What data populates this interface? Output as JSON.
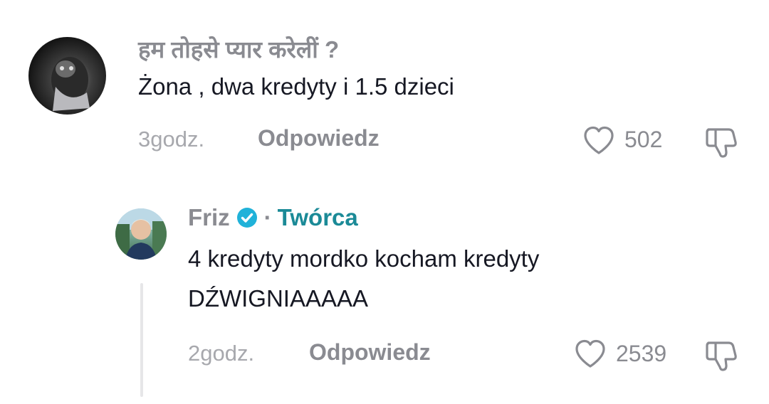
{
  "comments": [
    {
      "username": "हम तोहसे प्यार करेलीं ?",
      "text_lines": [
        "Żona , dwa kredyty i 1.5 dzieci"
      ],
      "time": "3godz.",
      "reply_label": "Odpowiedz",
      "likes": "502"
    }
  ],
  "reply": {
    "username": "Friz",
    "verified": true,
    "separator": "·",
    "creator_label": "Twórca",
    "text_lines": [
      "4 kredyty mordko kocham kredyty",
      "DŹWIGNIAAAAA"
    ],
    "time": "2godz.",
    "reply_label": "Odpowiedz",
    "likes": "2539"
  },
  "colors": {
    "creator_accent": "#1b8a97",
    "verified_badge": "#20b2d9",
    "muted_text": "#8a8b91"
  },
  "icons": [
    "heart-icon",
    "dislike-icon",
    "verified-icon"
  ]
}
